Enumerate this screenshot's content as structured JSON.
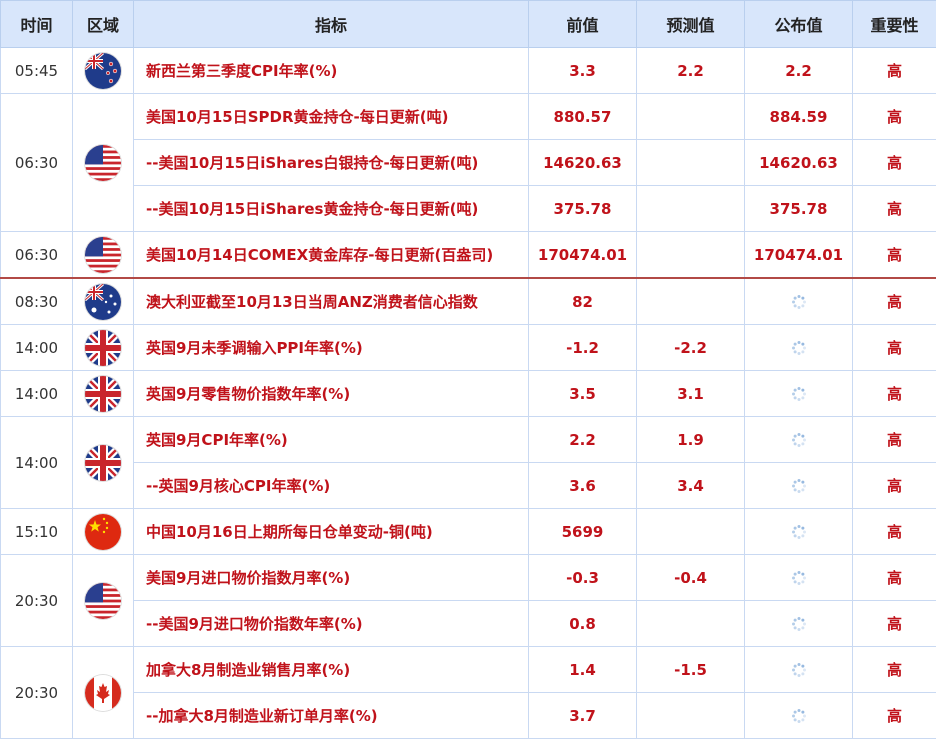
{
  "headers": {
    "time": "时间",
    "region": "区域",
    "indicator": "指标",
    "previous": "前值",
    "forecast": "预测值",
    "actual": "公布值",
    "importance": "重要性"
  },
  "groups": [
    {
      "time": "05:45",
      "flag": "new-zealand-flag-icon",
      "rows": [
        {
          "indicator": "新西兰第三季度CPI年率(%)",
          "previous": "3.3",
          "forecast": "2.2",
          "actual": "2.2",
          "importance": "高"
        }
      ]
    },
    {
      "time": "06:30",
      "flag": "us-flag-icon",
      "rows": [
        {
          "indicator": "美国10月15日SPDR黄金持仓-每日更新(吨)",
          "previous": "880.57",
          "forecast": "",
          "actual": "884.59",
          "importance": "高"
        },
        {
          "indicator": "--美国10月15日iShares白银持仓-每日更新(吨)",
          "previous": "14620.63",
          "forecast": "",
          "actual": "14620.63",
          "importance": "高"
        },
        {
          "indicator": "--美国10月15日iShares黄金持仓-每日更新(吨)",
          "previous": "375.78",
          "forecast": "",
          "actual": "375.78",
          "importance": "高"
        }
      ]
    },
    {
      "time": "06:30",
      "flag": "us-flag-icon",
      "rows": [
        {
          "indicator": "美国10月14日COMEX黄金库存-每日更新(百盎司)",
          "previous": "170474.01",
          "forecast": "",
          "actual": "170474.01",
          "importance": "高"
        }
      ]
    },
    {
      "time": "08:30",
      "flag": "australia-flag-icon",
      "rows": [
        {
          "indicator": "澳大利亚截至10月13日当周ANZ消费者信心指数",
          "previous": "82",
          "forecast": "",
          "actual": "",
          "importance": "高"
        }
      ]
    },
    {
      "time": "14:00",
      "flag": "uk-flag-icon",
      "rows": [
        {
          "indicator": "英国9月未季调输入PPI年率(%)",
          "previous": "-1.2",
          "forecast": "-2.2",
          "actual": "",
          "importance": "高"
        }
      ]
    },
    {
      "time": "14:00",
      "flag": "uk-flag-icon",
      "rows": [
        {
          "indicator": "英国9月零售物价指数年率(%)",
          "previous": "3.5",
          "forecast": "3.1",
          "actual": "",
          "importance": "高"
        }
      ]
    },
    {
      "time": "14:00",
      "flag": "uk-flag-icon",
      "rows": [
        {
          "indicator": "英国9月CPI年率(%)",
          "previous": "2.2",
          "forecast": "1.9",
          "actual": "",
          "importance": "高"
        },
        {
          "indicator": "--英国9月核心CPI年率(%)",
          "previous": "3.6",
          "forecast": "3.4",
          "actual": "",
          "importance": "高"
        }
      ]
    },
    {
      "time": "15:10",
      "flag": "china-flag-icon",
      "rows": [
        {
          "indicator": "中国10月16日上期所每日仓单变动-铜(吨)",
          "previous": "5699",
          "forecast": "",
          "actual": "",
          "importance": "高"
        }
      ]
    },
    {
      "time": "20:30",
      "flag": "us-flag-icon",
      "rows": [
        {
          "indicator": "美国9月进口物价指数月率(%)",
          "previous": "-0.3",
          "forecast": "-0.4",
          "actual": "",
          "importance": "高"
        },
        {
          "indicator": "--美国9月进口物价指数年率(%)",
          "previous": "0.8",
          "forecast": "",
          "actual": "",
          "importance": "高"
        }
      ]
    },
    {
      "time": "20:30",
      "flag": "canada-flag-icon",
      "rows": [
        {
          "indicator": "加拿大8月制造业销售月率(%)",
          "previous": "1.4",
          "forecast": "-1.5",
          "actual": "",
          "importance": "高"
        },
        {
          "indicator": "--加拿大8月制造业新订单月率(%)",
          "previous": "3.7",
          "forecast": "",
          "actual": "",
          "importance": "高"
        }
      ]
    }
  ],
  "colors": {
    "header_bg": "#d8e6fb",
    "text_red": "#c0121a",
    "grid": "#c9d9f2",
    "separator": "#b24a46"
  }
}
